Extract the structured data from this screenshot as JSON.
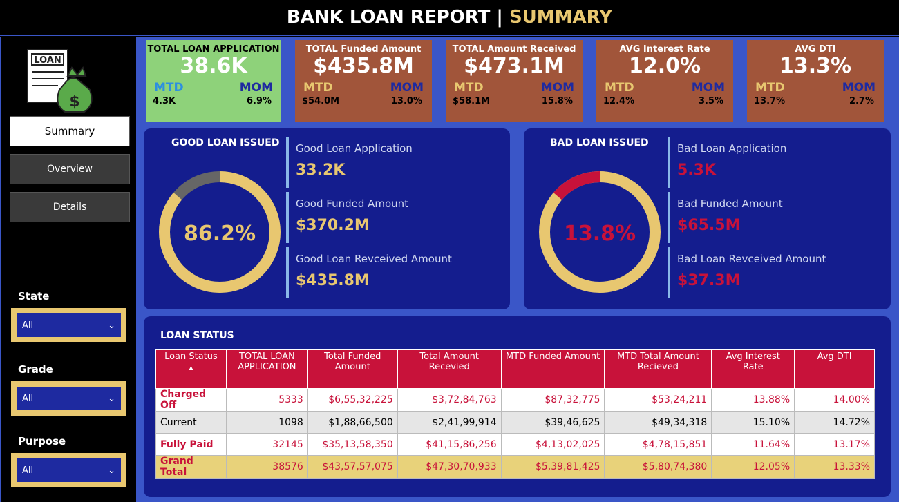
{
  "header": {
    "title_main": "BANK LOAN REPORT | ",
    "title_accent": "SUMMARY"
  },
  "logo": {
    "text": "LOAN"
  },
  "nav": [
    {
      "label": "Summary",
      "active": true
    },
    {
      "label": "Overview",
      "active": false
    },
    {
      "label": "Details",
      "active": false
    }
  ],
  "slicers": [
    {
      "label": "State",
      "value": "All"
    },
    {
      "label": "Grade",
      "value": "All"
    },
    {
      "label": "Purpose",
      "value": "All"
    }
  ],
  "kpis": [
    {
      "title": "TOTAL LOAN APPLICATION",
      "value": "38.6K",
      "mtd_label": "MTD",
      "mom_label": "MOM",
      "mtd": "4.3K",
      "mom": "6.9%"
    },
    {
      "title": "TOTAL Funded Amount",
      "value": "$435.8M",
      "mtd_label": "MTD",
      "mom_label": "MOM",
      "mtd": "$54.0M",
      "mom": "13.0%"
    },
    {
      "title": "TOTAL Amount Received",
      "value": "$473.1M",
      "mtd_label": "MTD",
      "mom_label": "MOM",
      "mtd": "$58.1M",
      "mom": "15.8%"
    },
    {
      "title": "AVG Interest Rate",
      "value": "12.0%",
      "mtd_label": "MTD",
      "mom_label": "MOM",
      "mtd": "12.4%",
      "mom": "3.5%"
    },
    {
      "title": "AVG DTI",
      "value": "13.3%",
      "mtd_label": "MTD",
      "mom_label": "MOM",
      "mtd": "13.7%",
      "mom": "2.7%"
    }
  ],
  "good": {
    "title": "GOOD LOAN ISSUED",
    "percent": "86.2%",
    "fraction": 0.862,
    "metrics": [
      {
        "label": "Good Loan Application",
        "value": "33.2K"
      },
      {
        "label": "Good Funded Amount",
        "value": "$370.2M"
      },
      {
        "label": "Good Loan Revceived Amount",
        "value": "$435.8M"
      }
    ]
  },
  "bad": {
    "title": "BAD LOAN ISSUED",
    "percent": "13.8%",
    "fraction": 0.138,
    "metrics": [
      {
        "label": "Bad Loan Application",
        "value": "5.3K"
      },
      {
        "label": "Bad Funded Amount",
        "value": "$65.5M"
      },
      {
        "label": "Bad Loan Revceived Amount",
        "value": "$37.3M"
      }
    ]
  },
  "loan_status": {
    "title": "LOAN STATUS",
    "sort_indicator": "▲",
    "headers": [
      "Loan Status",
      "TOTAL LOAN APPLICATION",
      "Total Funded Amount",
      "Total Amount Recevied",
      "MTD Funded Amount",
      "MTD Total Amount Recieved",
      "Avg Interest Rate",
      "Avg DTI"
    ],
    "rows": [
      [
        "Charged Off",
        "5333",
        "$6,55,32,225",
        "$3,72,84,763",
        "$87,32,775",
        "$53,24,211",
        "13.88%",
        "14.00%"
      ],
      [
        "Current",
        "1098",
        "$1,88,66,500",
        "$2,41,99,914",
        "$39,46,625",
        "$49,34,318",
        "15.10%",
        "14.72%"
      ],
      [
        "Fully Paid",
        "32145",
        "$35,13,58,350",
        "$41,15,86,256",
        "$4,13,02,025",
        "$4,78,15,851",
        "11.64%",
        "13.17%"
      ],
      [
        "Grand Total",
        "38576",
        "$43,57,57,075",
        "$47,30,70,933",
        "$5,39,81,425",
        "$5,80,74,380",
        "12.05%",
        "13.33%"
      ]
    ]
  },
  "colors": {
    "accent_gold": "#e8c770",
    "bad_red": "#c8123a",
    "panel_navy": "#141d8e",
    "kpi_brown": "#a1553a",
    "kpi_green": "#8ed27a",
    "donut_remainder_good": "#666666"
  }
}
